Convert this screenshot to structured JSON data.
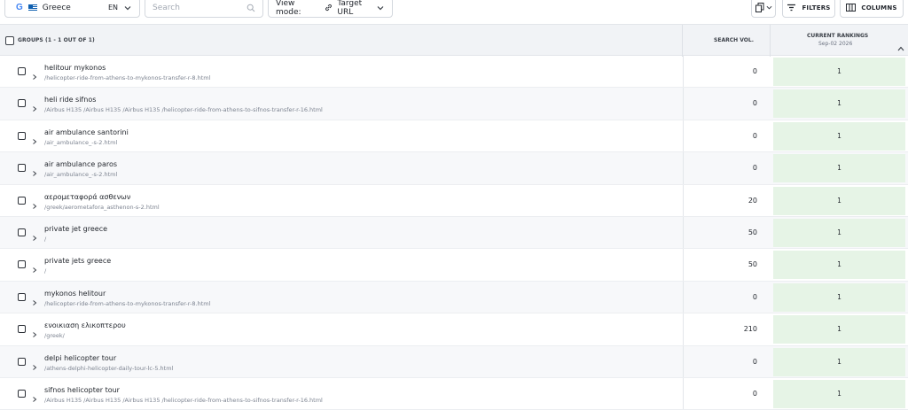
{
  "toolbar": {
    "country_logo": "G",
    "country": "Greece",
    "language": "EN",
    "search_placeholder": "Search",
    "view_mode_label": "View mode:",
    "view_mode_value": "Target URL",
    "filters_label": "FILTERS",
    "columns_label": "COLUMNS"
  },
  "table": {
    "groups_header": "GROUPS (1 - 1 OUT OF 1)",
    "volume_header": "SEARCH VOL.",
    "rankings_header": "CURRENT RANKINGS",
    "rankings_date": "Sep-02 2026",
    "rows": [
      {
        "keyword": "helitour mykonos",
        "url": "/helicopter-ride-from-athens-to-mykonos-transfer-r-8.html",
        "volume": "0",
        "rank": "1"
      },
      {
        "keyword": "heli ride sifnos",
        "url": "/Airbus H135 /Airbus H135 /Airbus H135 /helicopter-ride-from-athens-to-sifnos-transfer-r-16.html",
        "volume": "0",
        "rank": "1"
      },
      {
        "keyword": "air ambulance santorini",
        "url": "/air_ambulance_-s-2.html",
        "volume": "0",
        "rank": "1"
      },
      {
        "keyword": "air ambulance paros",
        "url": "/air_ambulance_-s-2.html",
        "volume": "0",
        "rank": "1"
      },
      {
        "keyword": "αερομεταφορά ασθενων",
        "url": "/greek/aerometafora_asthenon-s-2.html",
        "volume": "20",
        "rank": "1"
      },
      {
        "keyword": "private jet greece",
        "url": "/",
        "volume": "50",
        "rank": "1"
      },
      {
        "keyword": "private jets greece",
        "url": "/",
        "volume": "50",
        "rank": "1"
      },
      {
        "keyword": "mykonos helitour",
        "url": "/helicopter-ride-from-athens-to-mykonos-transfer-r-8.html",
        "volume": "0",
        "rank": "1"
      },
      {
        "keyword": "ενοικιαση ελικοπτερου",
        "url": "/greek/",
        "volume": "210",
        "rank": "1"
      },
      {
        "keyword": "delpi helicopter tour",
        "url": "/athens-delphi-helicopter-daily-tour-lc-5.html",
        "volume": "0",
        "rank": "1"
      },
      {
        "keyword": "sifnos helicopter tour",
        "url": "/Airbus H135 /Airbus H135 /Airbus H135 /helicopter-ride-from-athens-to-sifnos-transfer-r-16.html",
        "volume": "0",
        "rank": "1"
      }
    ]
  },
  "colors": {
    "rank_cell_bg": "#e6f4e6",
    "header_bg": "#f1f3f6",
    "alt_row_bg": "#f7f8fa"
  },
  "icons": [
    "google-icon",
    "greece-flag-icon",
    "chevron-down-icon",
    "search-icon",
    "link-icon",
    "copy-icon",
    "filter-icon",
    "columns-icon",
    "sort-up-icon",
    "expand-chevron-icon"
  ]
}
